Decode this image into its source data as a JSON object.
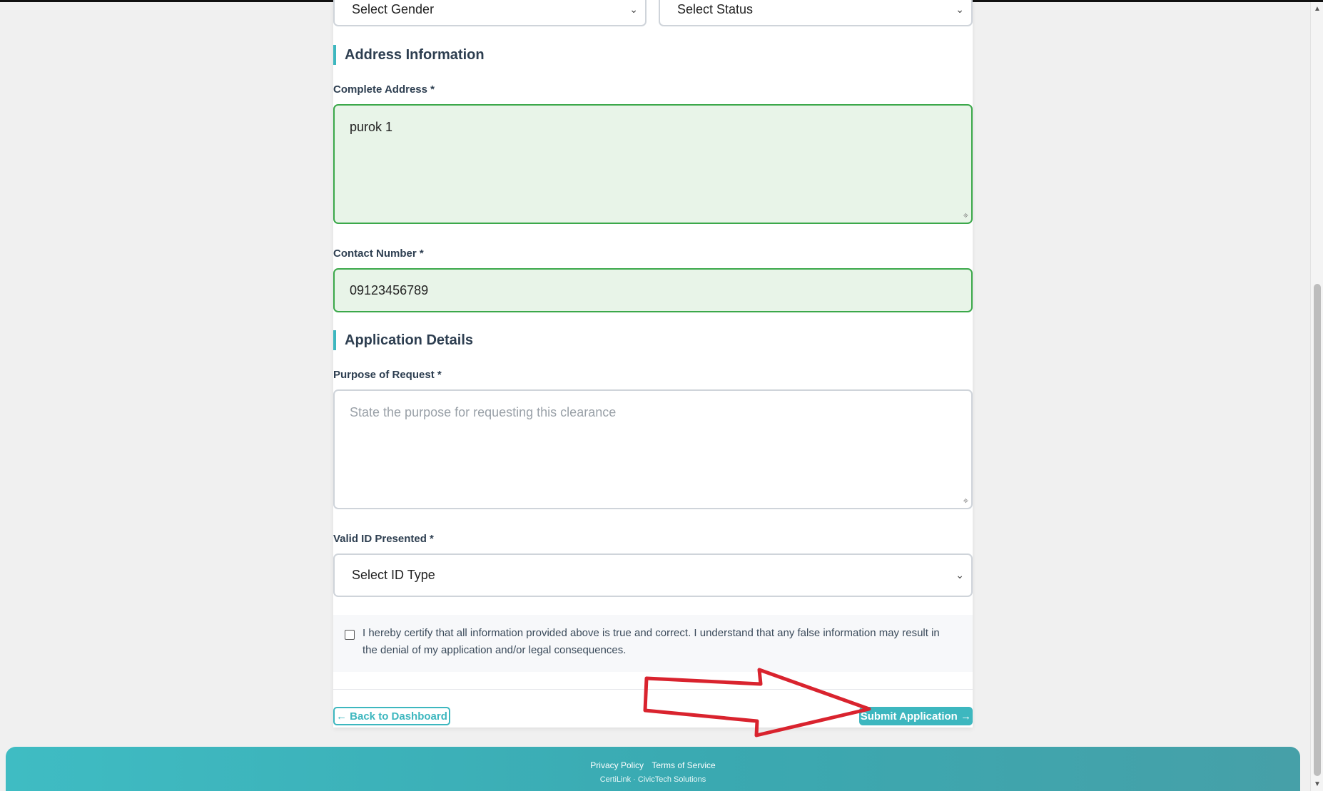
{
  "form": {
    "gender_select": {
      "value": "Select Gender"
    },
    "status_select": {
      "value": "Select Status"
    },
    "address_section": {
      "title": "Address Information",
      "address_label": "Complete Address *",
      "address_value": "purok 1",
      "contact_label": "Contact Number *",
      "contact_value": "09123456789"
    },
    "application_section": {
      "title": "Application Details",
      "purpose_label": "Purpose of Request *",
      "purpose_placeholder": "State the purpose for requesting this clearance",
      "id_label": "Valid ID Presented *",
      "id_select_value": "Select ID Type"
    },
    "certify": {
      "checked": false,
      "text": "I hereby certify that all information provided above is true and correct. I understand that any false information may result in the denial of my application and/or legal consequences."
    },
    "buttons": {
      "back_label": "← Back to Dashboard",
      "submit_label": "Submit Application →"
    }
  },
  "footer": {
    "privacy_link": "Privacy Policy",
    "terms_link": "Terms of Service",
    "copyright": "CertiLink · CivicTech Solutions"
  },
  "icons": {
    "select_chevron": "chevron-down-icon",
    "annotation": "red-arrow-annotation"
  },
  "colors": {
    "accent": "#3db7bf",
    "valid_border": "#3ba84a",
    "valid_fill": "#e8f4e8",
    "annotation_red": "#d9232e"
  }
}
